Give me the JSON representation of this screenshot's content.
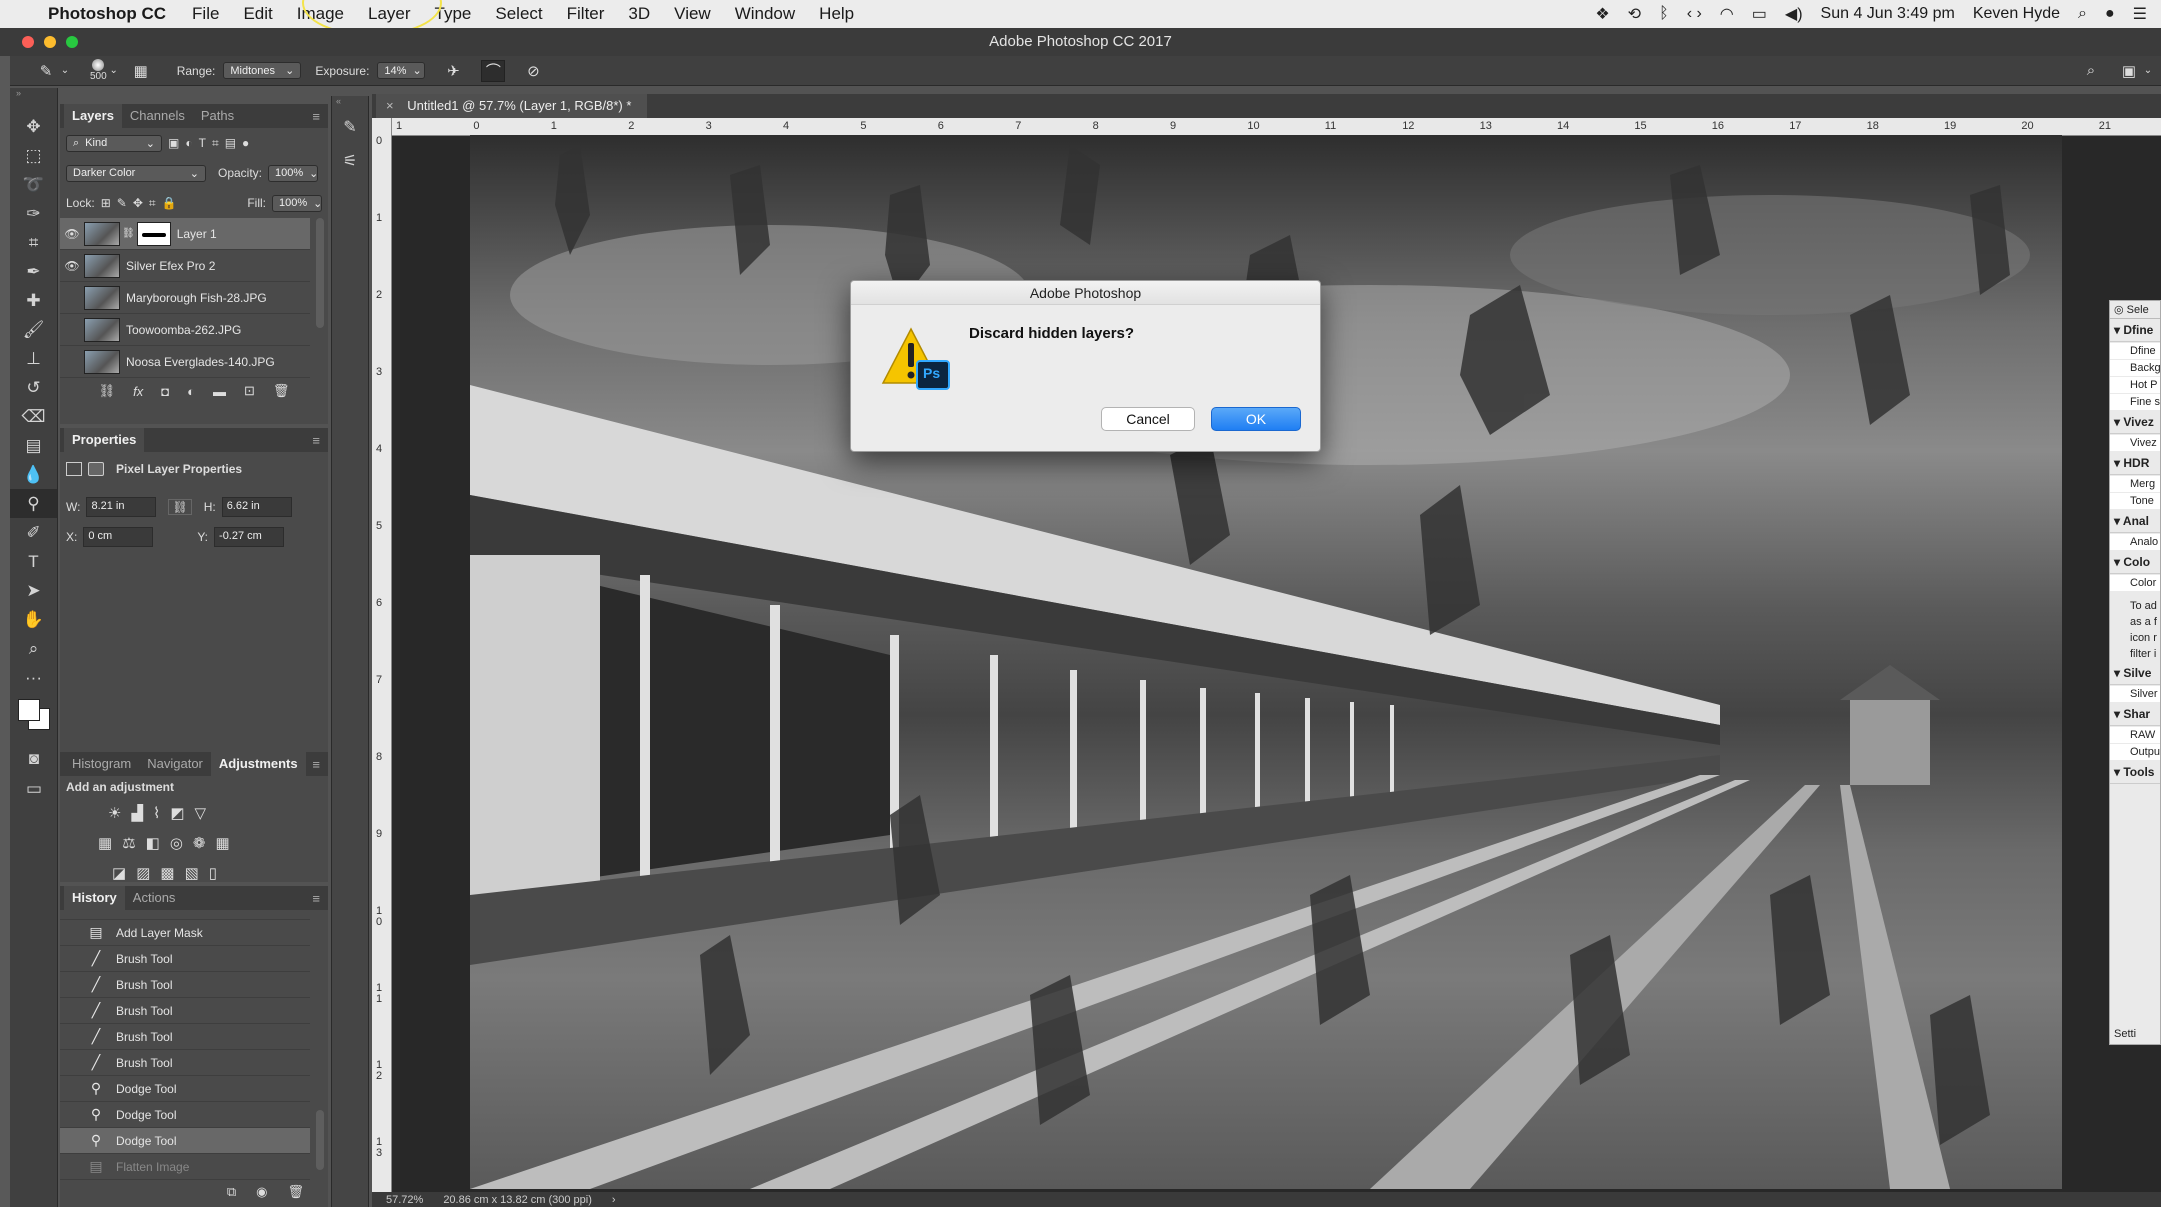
{
  "menubar": {
    "app_name": "Photoshop CC",
    "items": [
      "File",
      "Edit",
      "Image",
      "Layer",
      "Type",
      "Select",
      "Filter",
      "3D",
      "View",
      "Window",
      "Help"
    ],
    "clock": "Sun 4 Jun  3:49 pm",
    "user": "Keven Hyde"
  },
  "window": {
    "title": "Adobe Photoshop CC 2017"
  },
  "options": {
    "brush_size": "500",
    "range_label": "Range:",
    "range_value": "Midtones",
    "exposure_label": "Exposure:",
    "exposure_value": "14%"
  },
  "layers_panel": {
    "tabs": [
      "Layers",
      "Channels",
      "Paths"
    ],
    "filter_kind": "Kind",
    "blend_mode": "Darker Color",
    "opacity_label": "Opacity:",
    "opacity_value": "100%",
    "lock_label": "Lock:",
    "fill_label": "Fill:",
    "fill_value": "100%",
    "layers": [
      {
        "name": "Layer 1",
        "visible": true,
        "selected": true
      },
      {
        "name": "Silver Efex Pro 2",
        "visible": true,
        "selected": false
      },
      {
        "name": "Maryborough Fish-28.JPG",
        "visible": false,
        "selected": false
      },
      {
        "name": "Toowoomba-262.JPG",
        "visible": false,
        "selected": false
      },
      {
        "name": "Noosa Everglades-140.JPG",
        "visible": false,
        "selected": false
      }
    ]
  },
  "properties_panel": {
    "title": "Properties",
    "subtitle": "Pixel Layer Properties",
    "w_label": "W:",
    "w_value": "8.21 in",
    "h_label": "H:",
    "h_value": "6.62 in",
    "x_label": "X:",
    "x_value": "0 cm",
    "y_label": "Y:",
    "y_value": "-0.27 cm"
  },
  "adjustments_panel": {
    "tabs": [
      "Histogram",
      "Navigator",
      "Adjustments"
    ],
    "heading": "Add an adjustment"
  },
  "history_panel": {
    "tabs": [
      "History",
      "Actions"
    ],
    "steps": [
      {
        "name": "Add Layer Mask",
        "icon": "document-icon",
        "state": "normal"
      },
      {
        "name": "Brush Tool",
        "icon": "brush-icon",
        "state": "normal"
      },
      {
        "name": "Brush Tool",
        "icon": "brush-icon",
        "state": "normal"
      },
      {
        "name": "Brush Tool",
        "icon": "brush-icon",
        "state": "normal"
      },
      {
        "name": "Brush Tool",
        "icon": "brush-icon",
        "state": "normal"
      },
      {
        "name": "Brush Tool",
        "icon": "brush-icon",
        "state": "normal"
      },
      {
        "name": "Dodge Tool",
        "icon": "dodge-icon",
        "state": "normal"
      },
      {
        "name": "Dodge Tool",
        "icon": "dodge-icon",
        "state": "normal"
      },
      {
        "name": "Dodge Tool",
        "icon": "dodge-icon",
        "state": "selected"
      },
      {
        "name": "Flatten Image",
        "icon": "document-icon",
        "state": "dim"
      }
    ]
  },
  "document": {
    "tab_title": "Untitled1 @ 57.7% (Layer 1, RGB/8*) *",
    "ruler_top": [
      "1",
      "0",
      "1",
      "2",
      "3",
      "4",
      "5",
      "6",
      "7",
      "8",
      "9",
      "10",
      "11",
      "12",
      "13",
      "14",
      "15",
      "16",
      "17",
      "18",
      "19",
      "20",
      "21"
    ],
    "ruler_left": [
      "0",
      "1",
      "2",
      "3",
      "4",
      "5",
      "6",
      "7",
      "8",
      "9",
      "1 0",
      "1 1",
      "1 2",
      "1 3"
    ],
    "zoom": "57.72%",
    "doc_size": "20.86 cm x 13.82 cm (300 ppi)"
  },
  "nik_panel": {
    "title": "Sele",
    "sections": [
      {
        "name": "Dfine",
        "items": [
          "Dfine",
          "Backg",
          "Hot P",
          "Fine s"
        ]
      },
      {
        "name": "Vivez",
        "items": [
          "Vivez"
        ]
      },
      {
        "name": "HDR",
        "items": [
          "Merg",
          "Tone"
        ]
      },
      {
        "name": "Anal",
        "items": [
          "Analo"
        ]
      },
      {
        "name": "Colo",
        "items": [
          "Color"
        ]
      }
    ],
    "note": "To ad\nas a f\nicon r\nfilter i",
    "sections2": [
      {
        "name": "Silve",
        "items": [
          "Silver"
        ]
      },
      {
        "name": "Shar",
        "items": [
          "RAW",
          "Outpu"
        ]
      },
      {
        "name": "Tools",
        "items": []
      }
    ],
    "footer": "Setti"
  },
  "dialog": {
    "title": "Adobe Photoshop",
    "message": "Discard hidden layers?",
    "badge": "Ps",
    "cancel_label": "Cancel",
    "ok_label": "OK"
  },
  "colors": {
    "accent_button": "#1f7ef3",
    "panel_bg": "#4a4a4a",
    "highlight_ellipse": "#f3e34a"
  }
}
